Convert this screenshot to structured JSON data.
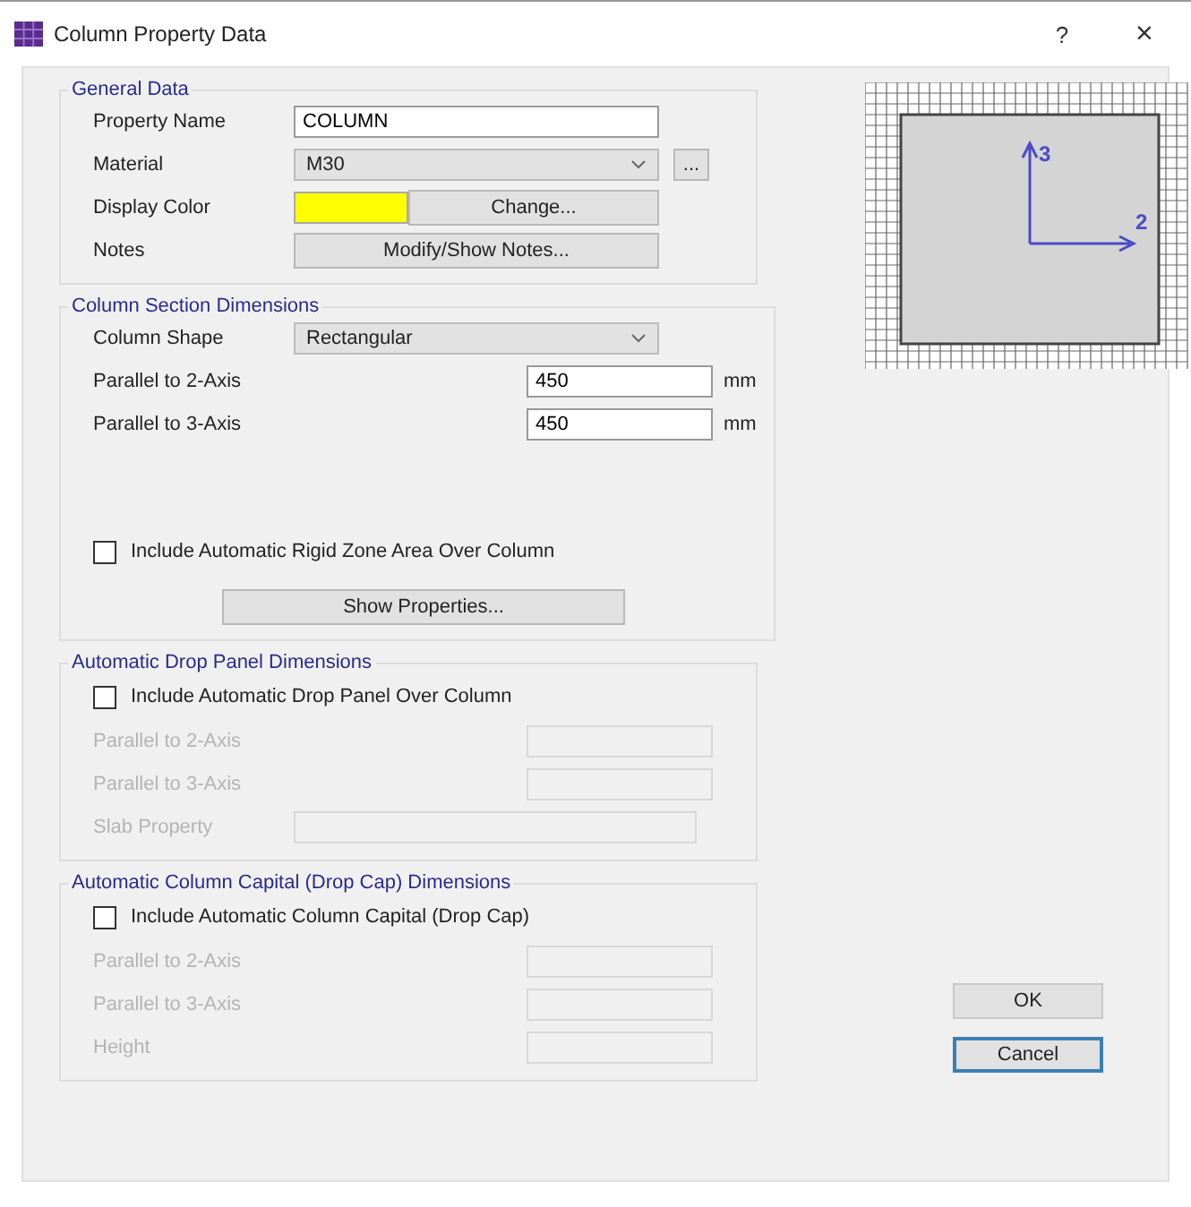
{
  "window": {
    "title": "Column Property Data",
    "help": "?",
    "close": "×"
  },
  "general": {
    "title": "General Data",
    "property_name": {
      "label": "Property Name",
      "value": "COLUMN"
    },
    "material": {
      "label": "Material",
      "value": "M30",
      "more": "..."
    },
    "display_color": {
      "label": "Display Color",
      "color": "#ffff00",
      "button": "Change..."
    },
    "notes": {
      "label": "Notes",
      "button": "Modify/Show Notes..."
    }
  },
  "section": {
    "title": "Column Section Dimensions",
    "shape": {
      "label": "Column Shape",
      "value": "Rectangular"
    },
    "dims": [
      {
        "label": "Parallel to 2-Axis",
        "value": "450",
        "unit": "mm"
      },
      {
        "label": "Parallel to 3-Axis",
        "value": "450",
        "unit": "mm"
      }
    ],
    "rigid_zone": {
      "label": "Include Automatic Rigid Zone Area Over Column",
      "checked": false
    },
    "button": "Show Properties..."
  },
  "drop_panel": {
    "title": "Automatic Drop Panel Dimensions",
    "include": {
      "label": "Include Automatic Drop Panel Over Column",
      "checked": false
    },
    "fields": [
      {
        "label": "Parallel to 2-Axis",
        "kind": "short",
        "disabled": true
      },
      {
        "label": "Parallel to 3-Axis",
        "kind": "short",
        "disabled": true
      },
      {
        "label": "Slab Property",
        "kind": "wide",
        "disabled": true
      }
    ]
  },
  "drop_cap": {
    "title": "Automatic Column Capital (Drop Cap) Dimensions",
    "include": {
      "label": "Include Automatic Column Capital (Drop Cap)",
      "checked": false
    },
    "fields": [
      {
        "label": "Parallel to 2-Axis",
        "kind": "short",
        "disabled": true
      },
      {
        "label": "Parallel to 3-Axis",
        "kind": "short",
        "disabled": true
      },
      {
        "label": "Height",
        "kind": "short",
        "disabled": true
      }
    ]
  },
  "preview": {
    "axis_vertical": "3",
    "axis_horizontal": "2"
  },
  "buttons": [
    {
      "label": "OK",
      "focused": false
    },
    {
      "label": "Cancel",
      "focused": true
    }
  ]
}
